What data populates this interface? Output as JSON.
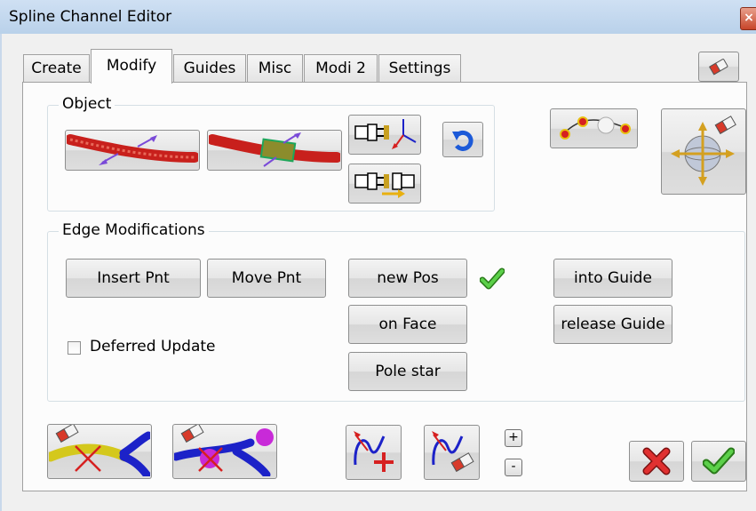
{
  "window": {
    "title": "Spline Channel Editor",
    "close_symbol": "×"
  },
  "tabs": [
    {
      "label": "Create"
    },
    {
      "label": "Modify"
    },
    {
      "label": "Guides"
    },
    {
      "label": "Misc"
    },
    {
      "label": "Modi 2"
    },
    {
      "label": "Settings"
    }
  ],
  "active_tab": "Modify",
  "object_group": {
    "label": "Object"
  },
  "edge_group": {
    "label": "Edge Modifications"
  },
  "buttons": {
    "insert_pnt": "Insert Pnt",
    "move_pnt": "Move Pnt",
    "new_pos": "new Pos",
    "on_face": "on Face",
    "pole_star": "Pole star",
    "into_guide": "into Guide",
    "release_guide": "release Guide"
  },
  "deferred_update": {
    "label": "Deferred Update",
    "checked": false
  },
  "stepper": {
    "plus": "+",
    "minus": "-"
  },
  "colors": {
    "spline_red": "#c8201c",
    "spline_yellow": "#d4c81c",
    "spline_blue": "#1c22c8",
    "arrow_purple": "#7a4ad8",
    "check_green": "#3cb52a",
    "cancel_red": "#d62020"
  }
}
